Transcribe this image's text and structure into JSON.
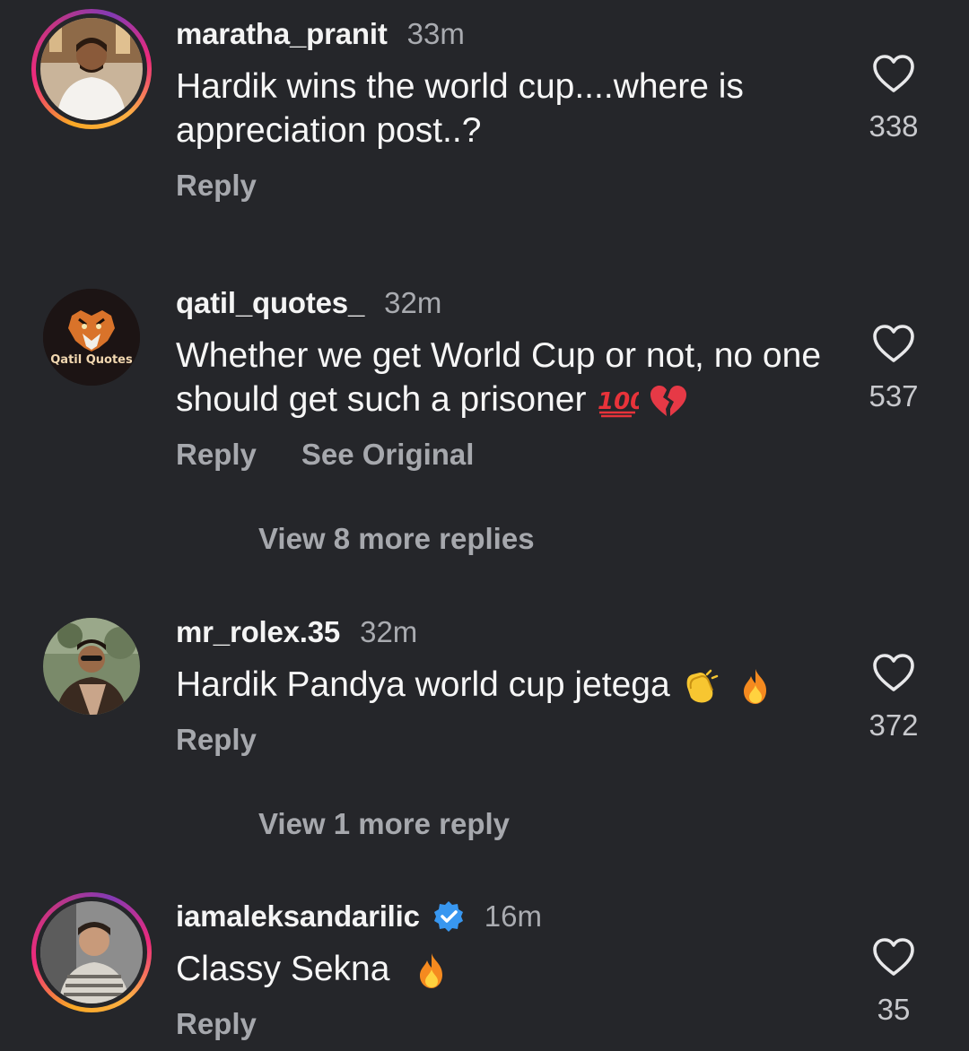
{
  "comments": [
    {
      "username": "maratha_pranit",
      "time": "33m",
      "text": "Hardik wins the world cup....where is appreciation post..?",
      "likes": "338",
      "reply_label": "Reply"
    },
    {
      "username": "qatil_quotes_",
      "time": "32m",
      "text": "Whether we get World Cup or not, no one should get such a prisoner",
      "likes": "537",
      "reply_label": "Reply",
      "see_original_label": "See Original",
      "avatar_text": "Qatil Quotes",
      "view_more": "View 8 more replies"
    },
    {
      "username": "mr_rolex.35",
      "time": "32m",
      "text": "Hardik Pandya world cup jetega",
      "likes": "372",
      "reply_label": "Reply",
      "view_more": "View 1 more reply"
    },
    {
      "username": "iamaleksandarilic",
      "time": "16m",
      "text": "Classy Sekna",
      "likes": "35",
      "reply_label": "Reply",
      "verified": true
    }
  ],
  "icons": {
    "like": "heart-outline-icon",
    "verified": "verified-badge-icon",
    "emojis": [
      "hundred-points-emoji",
      "broken-heart-emoji",
      "clapping-hands-emoji",
      "fire-emoji"
    ]
  },
  "colors": {
    "background": "#25262a",
    "muted_text": "#a6a8ad",
    "verified_blue": "#3897f0",
    "story_ring": "#ee2a7b"
  }
}
